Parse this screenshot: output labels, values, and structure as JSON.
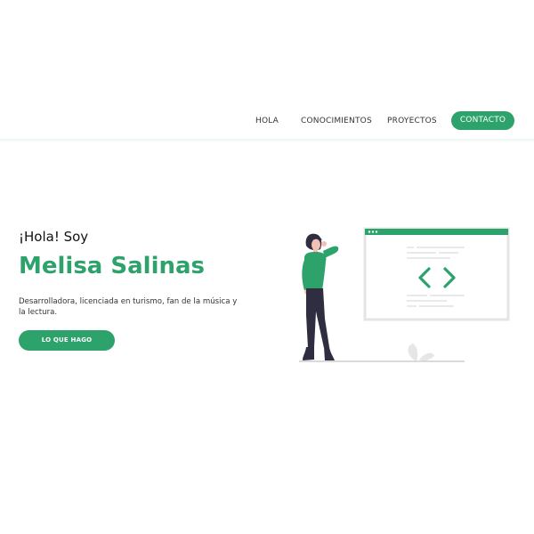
{
  "colors": {
    "accent": "#2ea26b",
    "text": "#111111"
  },
  "nav": {
    "items": [
      {
        "label": "HOLA"
      },
      {
        "label": "CONOCIMIENTOS"
      },
      {
        "label": "PROYECTOS"
      }
    ],
    "cta_label": "CONTACTO"
  },
  "hero": {
    "greeting": "¡Hola! Soy",
    "name": "Melisa Salinas",
    "description": "Desarrolladora, licenciada en turismo, fan de la música y la lectura.",
    "button_label": "LO QUE HAGO"
  },
  "illustration": {
    "icon": "code-brackets-icon",
    "subject": "woman-thinking"
  }
}
